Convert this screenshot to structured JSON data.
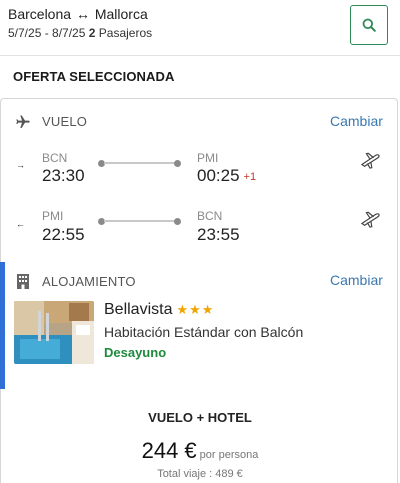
{
  "header": {
    "origin": "Barcelona",
    "destination": "Mallorca",
    "route_arrow": "↔",
    "dates": "5/7/25 - 8/7/25",
    "passengers_count": "2",
    "passengers_label": "Pasajeros",
    "search_icon": "search-icon"
  },
  "selected_offer": {
    "title": "OFERTA SELECCIONADA"
  },
  "flight": {
    "label": "VUELO",
    "change_label": "Cambiar",
    "outbound": {
      "direction": "→",
      "from_code": "BCN",
      "departure_time": "23:30",
      "to_code": "PMI",
      "arrival_time": "00:25",
      "day_offset": "+1"
    },
    "return": {
      "direction": "←",
      "from_code": "PMI",
      "departure_time": "22:55",
      "to_code": "BCN",
      "arrival_time": "23:55"
    }
  },
  "accommodation": {
    "label": "ALOJAMIENTO",
    "change_label": "Cambiar",
    "hotel_name": "Bellavista",
    "stars": "★★★",
    "room": "Habitación Estándar con Balcón",
    "meal_plan": "Desayuno"
  },
  "price": {
    "package_label": "VUELO + HOTEL",
    "amount": "244 €",
    "per_person_label": "por persona",
    "total_label": "Total viaje : 489 €"
  },
  "colors": {
    "accent_blue": "#2f6fd6",
    "link_blue": "#3a78b0",
    "green": "#1e8a3c",
    "star": "#f0a500",
    "day_offset_red": "#c0392b"
  }
}
